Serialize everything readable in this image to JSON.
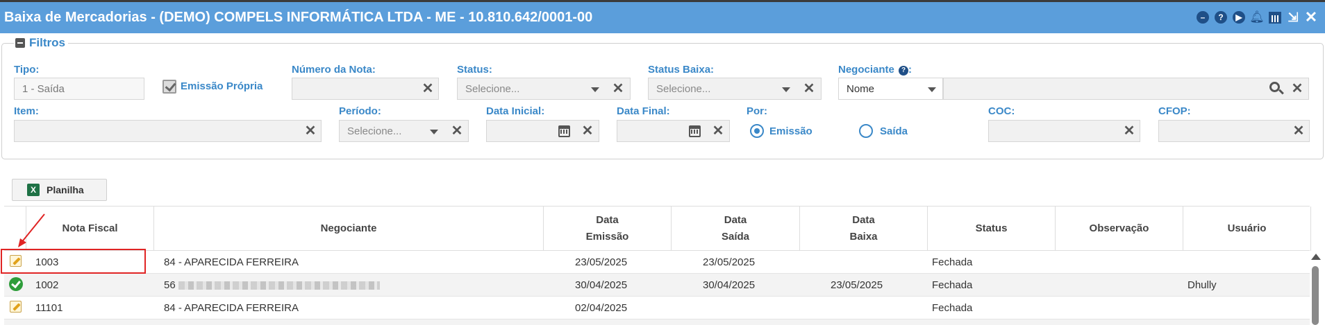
{
  "window": {
    "title": "Baixa de Mercadorias - (DEMO) COMPELS INFORMÁTICA LTDA - ME - 10.810.642/0001-00",
    "icons": [
      "minimize-circle-icon",
      "help-icon",
      "play-icon",
      "bell-icon",
      "calendar-icon",
      "compress-icon",
      "close-icon"
    ]
  },
  "filters": {
    "legend": "Filtros",
    "tipo": {
      "label": "Tipo:",
      "value": "1 - Saída"
    },
    "emissao_propria": {
      "label": "Emissão Própria",
      "checked": true
    },
    "numero_nota": {
      "label": "Número da Nota:",
      "value": ""
    },
    "status": {
      "label": "Status:",
      "placeholder": "Selecione..."
    },
    "status_baixa": {
      "label": "Status Baixa:",
      "placeholder": "Selecione..."
    },
    "negociante": {
      "label": "Negociante",
      "help": "?",
      "colon": ":",
      "type_value": "Nome",
      "value": ""
    },
    "item": {
      "label": "Item:",
      "value": ""
    },
    "periodo": {
      "label": "Período:",
      "placeholder": "Selecione..."
    },
    "data_inicial": {
      "label": "Data Inicial:",
      "value": ""
    },
    "data_final": {
      "label": "Data Final:",
      "value": ""
    },
    "por": {
      "label": "Por:",
      "options": [
        "Emissão",
        "Saída"
      ],
      "selected": "Emissão"
    },
    "coc": {
      "label": "COC:",
      "value": ""
    },
    "cfop": {
      "label": "CFOP:",
      "value": ""
    }
  },
  "toolbar": {
    "planilha_label": "Planilha",
    "excel_icon_letter": "X"
  },
  "grid": {
    "columns": [
      {
        "label": "Nota Fiscal"
      },
      {
        "label": "Negociante"
      },
      {
        "line1": "Data",
        "line2": "Emissão"
      },
      {
        "line1": "Data",
        "line2": "Saída"
      },
      {
        "line1": "Data",
        "line2": "Baixa"
      },
      {
        "label": "Status"
      },
      {
        "label": "Observação"
      },
      {
        "label": "Usuário"
      }
    ],
    "rows": [
      {
        "icon": "edit-icon",
        "nota": "1003",
        "negociante": "84 - APARECIDA FERREIRA",
        "emissao": "23/05/2025",
        "saida": "23/05/2025",
        "baixa": "",
        "status": "Fechada",
        "observacao": "",
        "usuario": ""
      },
      {
        "icon": "check-circle-icon",
        "nota": "1002",
        "negociante": "56",
        "emissao": "30/04/2025",
        "saida": "30/04/2025",
        "baixa": "23/05/2025",
        "status": "Fechada",
        "observacao": "",
        "usuario": "Dhully"
      },
      {
        "icon": "edit-icon",
        "nota": "11101",
        "negociante": "84 - APARECIDA FERREIRA",
        "emissao": "02/04/2025",
        "saida": "",
        "baixa": "",
        "status": "Fechada",
        "observacao": "",
        "usuario": ""
      }
    ]
  },
  "colors": {
    "titlebar": "#5b9edb",
    "label": "#3a88c8",
    "highlight": "#e02424",
    "ok": "#2e9d3a"
  }
}
